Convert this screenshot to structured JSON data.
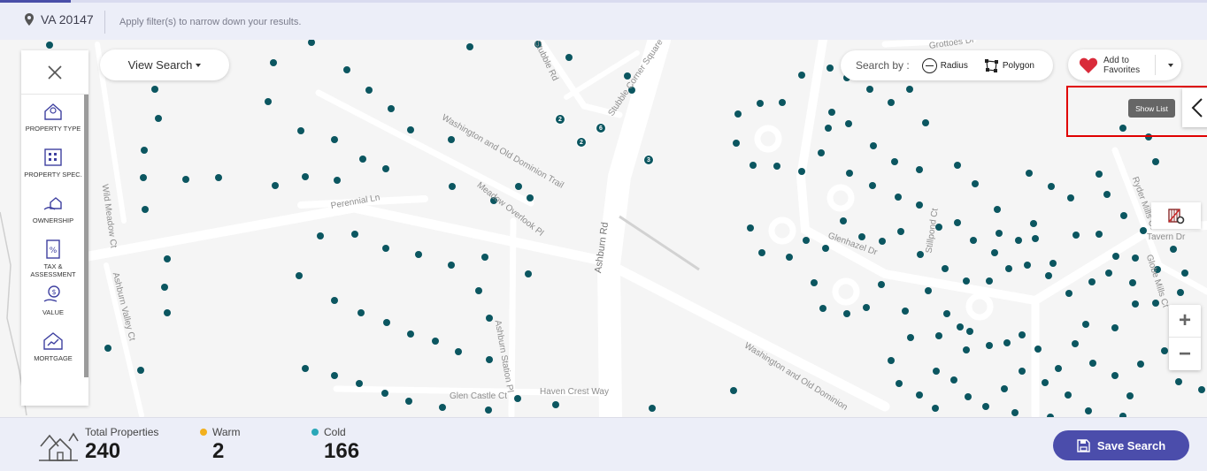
{
  "topbar": {
    "location": "VA 20147",
    "hint": "Apply filter(s) to narrow down your results."
  },
  "filters": {
    "items": [
      {
        "label": "PROPERTY TYPE",
        "icon": "house-pin-icon"
      },
      {
        "label": "PROPERTY SPEC.",
        "icon": "building-icon"
      },
      {
        "label": "OWNERSHIP",
        "icon": "hand-house-icon"
      },
      {
        "label": "TAX & ASSESSMENT",
        "icon": "tax-document-icon"
      },
      {
        "label": "VALUE",
        "icon": "hand-dollar-icon"
      },
      {
        "label": "MORTGAGE",
        "icon": "house-chart-icon"
      }
    ]
  },
  "map": {
    "view_search_label": "View Search",
    "search_by": {
      "label": "Search by :",
      "radius": "Radius",
      "polygon": "Polygon"
    },
    "favorites_label": "Add to Favorites",
    "show_list_tooltip": "Show List",
    "road_labels": [
      "Washington and Old Dominion Trail",
      "Meadow Overlook Pl",
      "Perennial Ln",
      "Ashburn Rd",
      "Ashburn Station Pl",
      "Glen Castle Ct",
      "Haven Crest Way",
      "Washington and Old Dominion",
      "Wild Meadow Ct",
      "Ashburn Valley Ct",
      "Stubble Rd",
      "Stubble Corner Square",
      "Glenhazel Dr",
      "Stillpond Ct",
      "Ryder Mills Ct",
      "Tavern Dr",
      "Globe Mills Ct",
      "Grottoes Dr"
    ],
    "clusters": [
      "2",
      "6",
      "2",
      "3"
    ],
    "colors": {
      "marker": "#0b5660",
      "accent": "#4b4dab",
      "highlight": "#e00000"
    }
  },
  "stats": {
    "total": {
      "label": "Total Properties",
      "value": "240"
    },
    "warm": {
      "label": "Warm",
      "value": "2",
      "color": "#f2b01e"
    },
    "cold": {
      "label": "Cold",
      "value": "166",
      "color": "#2aa7b8"
    }
  },
  "save_search_label": "Save Search"
}
